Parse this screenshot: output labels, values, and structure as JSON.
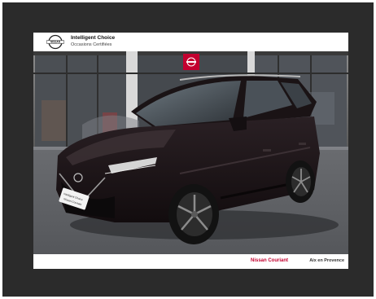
{
  "header": {
    "logo_text": "NISSAN",
    "title": "Intelligent Choice",
    "subtitle": "Occasions Certifiées"
  },
  "photo": {
    "plate_line1": "Intelligent Choice",
    "plate_line2": "Nissan Courtant"
  },
  "footer": {
    "dealer_name": "Nissan Couriant",
    "dealer_city": "Aix en Provence"
  },
  "colors": {
    "frame": "#2b2b2b",
    "nissan_red": "#c3002f",
    "car_body": "#1c1416",
    "road": "#5f6165"
  }
}
